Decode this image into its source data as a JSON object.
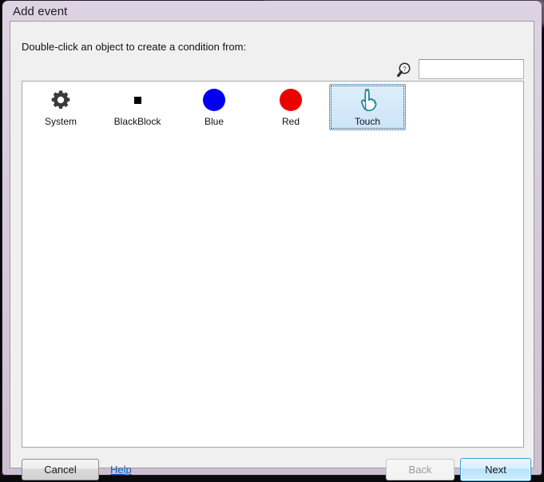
{
  "window": {
    "title": "Add event"
  },
  "dialog": {
    "instruction": "Double-click an object to create a condition from:",
    "search": {
      "icon": "search-help-icon",
      "value": "",
      "placeholder": ""
    },
    "objects": [
      {
        "label": "System",
        "icon": "gear-icon",
        "selected": false
      },
      {
        "label": "BlackBlock",
        "icon": "black-square-icon",
        "selected": false
      },
      {
        "label": "Blue",
        "icon": "blue-circle-icon",
        "selected": false
      },
      {
        "label": "Red",
        "icon": "red-circle-icon",
        "selected": false
      },
      {
        "label": "Touch",
        "icon": "pointing-hand-icon",
        "selected": true
      }
    ],
    "footer": {
      "cancel_label": "Cancel",
      "help_label": "Help",
      "back_label": "Back",
      "next_label": "Next"
    }
  },
  "colors": {
    "blue_object": "#0000ee",
    "red_object": "#ee0000",
    "black_object": "#000000",
    "touch_outline": "#1b7f95",
    "selection_fill": "#cbe5f8",
    "selection_border": "#7da2ce",
    "default_button_border": "#3c9cd4",
    "help_link": "#0b5ec7",
    "title_bar": "#d9cedd"
  }
}
